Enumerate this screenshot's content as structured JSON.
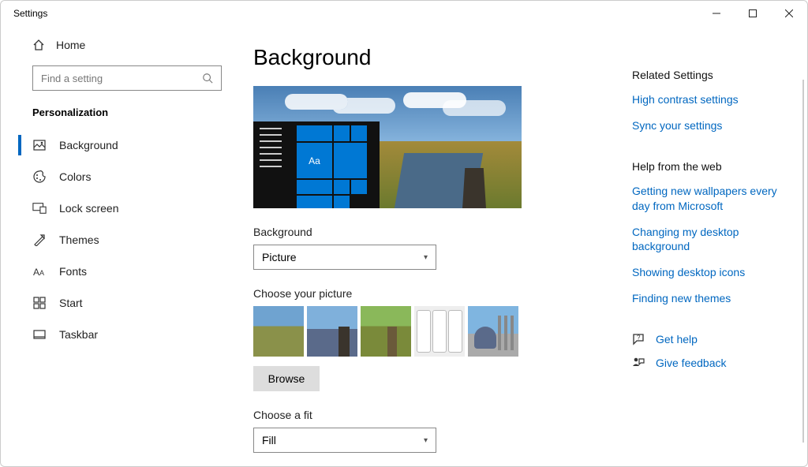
{
  "window": {
    "title": "Settings"
  },
  "sidebar": {
    "home_label": "Home",
    "search_placeholder": "Find a setting",
    "section": "Personalization",
    "items": [
      {
        "label": "Background",
        "icon": "background-icon",
        "selected": true
      },
      {
        "label": "Colors",
        "icon": "colors-icon",
        "selected": false
      },
      {
        "label": "Lock screen",
        "icon": "lockscreen-icon",
        "selected": false
      },
      {
        "label": "Themes",
        "icon": "themes-icon",
        "selected": false
      },
      {
        "label": "Fonts",
        "icon": "fonts-icon",
        "selected": false
      },
      {
        "label": "Start",
        "icon": "start-icon",
        "selected": false
      },
      {
        "label": "Taskbar",
        "icon": "taskbar-icon",
        "selected": false
      }
    ]
  },
  "main": {
    "title": "Background",
    "preview_tile_text": "Aa",
    "background_label": "Background",
    "background_value": "Picture",
    "choose_picture_label": "Choose your picture",
    "browse_label": "Browse",
    "fit_label": "Choose a fit",
    "fit_value": "Fill"
  },
  "related": {
    "heading": "Related Settings",
    "links": [
      "High contrast settings",
      "Sync your settings"
    ]
  },
  "webhelp": {
    "heading": "Help from the web",
    "links": [
      "Getting new wallpapers every day from Microsoft",
      "Changing my desktop background",
      "Showing desktop icons",
      "Finding new themes"
    ]
  },
  "support": {
    "gethelp": "Get help",
    "feedback": "Give feedback"
  },
  "colors": {
    "accent": "#0067c0",
    "tile": "#0078d4"
  }
}
